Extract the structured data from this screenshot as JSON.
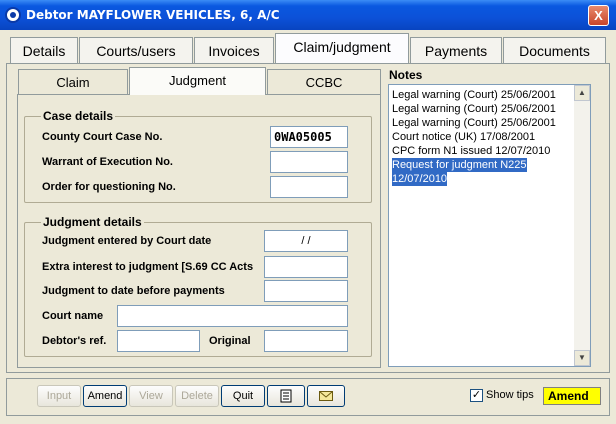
{
  "window": {
    "title": "Debtor MAYFLOWER VEHICLES, 6,   A/C",
    "close_label": "X"
  },
  "main_tabs": [
    {
      "label": "Details"
    },
    {
      "label": "Courts/users"
    },
    {
      "label": "Invoices"
    },
    {
      "label": "Claim/judgment",
      "active": true
    },
    {
      "label": "Payments"
    },
    {
      "label": "Documents"
    }
  ],
  "sub_tabs": [
    {
      "label": "Claim"
    },
    {
      "label": "Judgment",
      "active": true
    },
    {
      "label": "CCBC"
    }
  ],
  "case_details": {
    "legend": "Case details",
    "county_court_case_label": "County Court Case No.",
    "county_court_case_value": "0WA05005",
    "warrant_label": "Warrant of Execution No.",
    "warrant_value": "",
    "order_label": "Order for questioning No.",
    "order_value": ""
  },
  "judgment_details": {
    "legend": "Judgment details",
    "entered_date_label": "Judgment entered by Court date",
    "entered_date_value": "/  /",
    "extra_interest_label": "Extra interest to judgment [S.69 CC Acts",
    "extra_interest_value": "",
    "to_date_label": "Judgment to date before payments",
    "to_date_value": "",
    "court_name_label": "Court name",
    "court_name_value": "",
    "debtors_ref_label": "Debtor's ref.",
    "debtors_ref_value": "",
    "original_label": "Original",
    "original_value": ""
  },
  "notes": {
    "label": "Notes",
    "lines": [
      {
        "text": "Legal warning (Court) 25/06/2001",
        "selected": false
      },
      {
        "text": "Legal warning (Court) 25/06/2001",
        "selected": false
      },
      {
        "text": "Legal warning (Court) 25/06/2001",
        "selected": false
      },
      {
        "text": "Court notice (UK) 17/08/2001",
        "selected": false
      },
      {
        "text": "CPC form N1 issued 12/07/2010",
        "selected": false
      },
      {
        "text": "Request for judgment N225",
        "selected": true
      },
      {
        "text": "12/07/2010",
        "selected": true
      }
    ]
  },
  "toolbar": {
    "input_label": "Input",
    "amend_label": "Amend",
    "view_label": "View",
    "delete_label": "Delete",
    "quit_label": "Quit",
    "document_icon": "document-icon",
    "email_icon": "envelope-icon"
  },
  "footer": {
    "show_tips_label": "Show tips",
    "show_tips_checked": true,
    "mode": "Amend"
  },
  "colors": {
    "titlebar": "#0a58e0",
    "selection": "#316ac5",
    "mode_badge": "#ffff00"
  }
}
